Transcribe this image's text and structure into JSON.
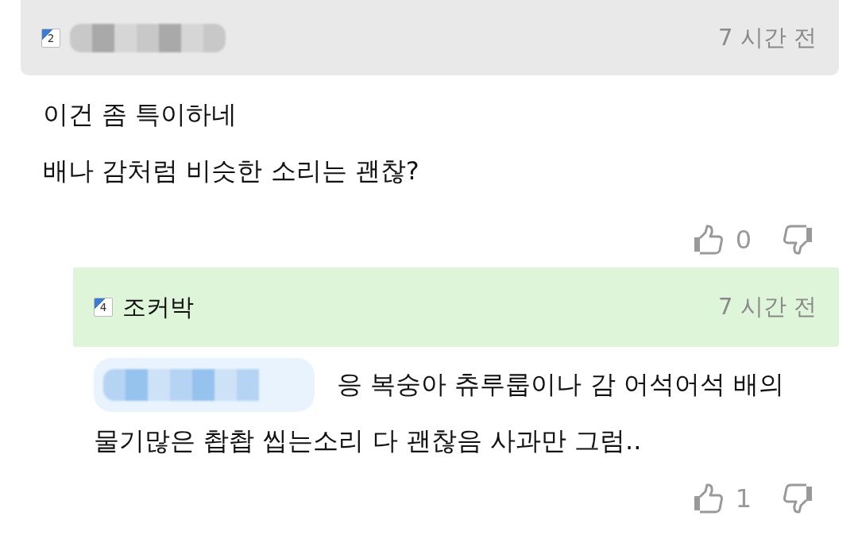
{
  "comments": [
    {
      "kind": "comment",
      "level": "2",
      "author_redacted": true,
      "time": "7 시간 전",
      "mention_redacted": false,
      "lines": [
        "이건 좀 특이하네",
        "배나 감처럼 비슷한 소리는 괜찮?"
      ],
      "likes": "0"
    },
    {
      "kind": "reply",
      "level": "4",
      "author_redacted": false,
      "author": "조커박",
      "time": "7 시간 전",
      "mention_redacted": true,
      "lines": [
        "응 복숭아 츄루룹이나 감 어석어석 배의",
        "물기많은 촵촵 씹는소리 다 괜찮음 사과만 그럼.."
      ],
      "likes": "1"
    }
  ]
}
